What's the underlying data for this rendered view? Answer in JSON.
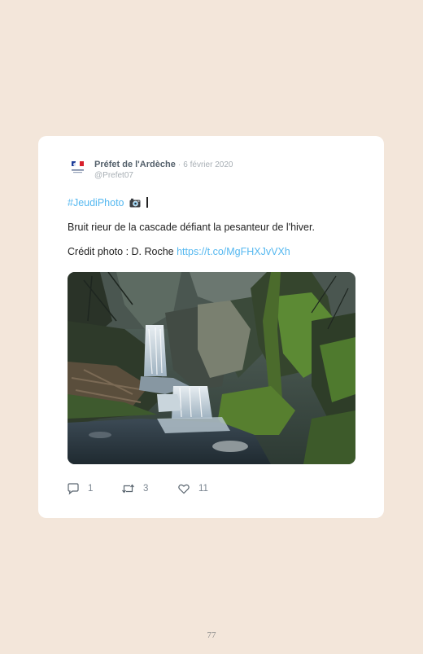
{
  "tweet": {
    "author_name": "Préfet de l'Ardèche",
    "separator": "·",
    "date": "6 février 2020",
    "handle": "@Prefet07",
    "hashtag": "#JeudiPhoto",
    "body_line": "Bruit rieur de la cascade défiant la pesanteur de l'hiver.",
    "credit_text": "Crédit photo : D. Roche",
    "link_text": "https://t.co/MgFHXJvVXh",
    "image_alt": "Waterfall cascading over mossy rocks in a forest stream"
  },
  "actions": {
    "replies": "1",
    "retweets": "3",
    "likes": "11",
    "icons": [
      "reply-icon",
      "retweet-icon",
      "like-icon"
    ]
  },
  "page": {
    "number": "77"
  },
  "colors": {
    "background": "#f3e6da",
    "card": "#ffffff",
    "link": "#55b8f0",
    "author": "#54606b",
    "meta": "#a7aeb4"
  }
}
